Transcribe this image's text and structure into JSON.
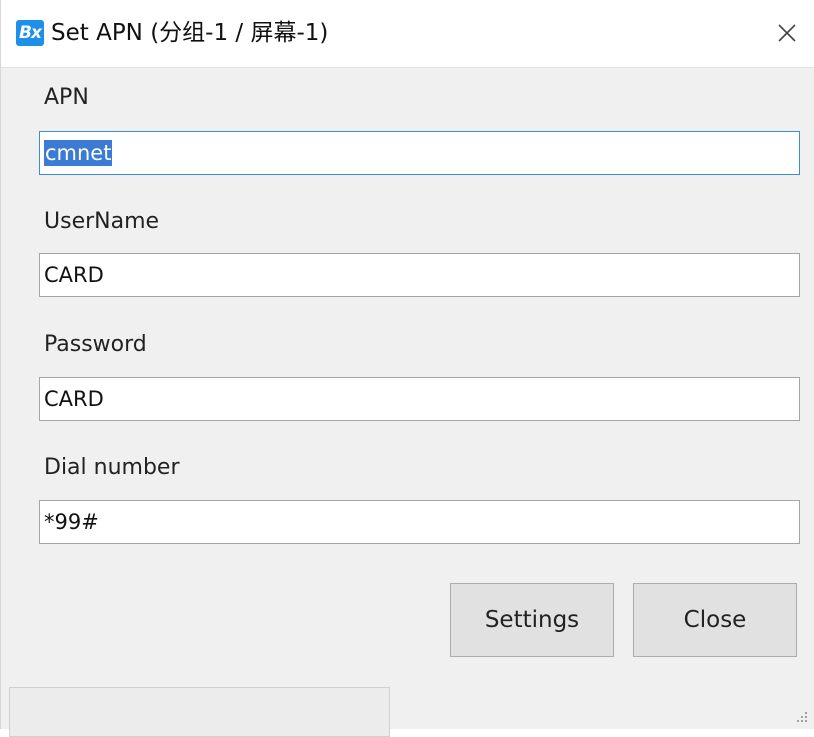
{
  "window": {
    "title": "Set APN  (分组-1 / 屏幕-1)",
    "app_icon_text": "Bx",
    "close_icon": "close-icon"
  },
  "form": {
    "apn_label": "APN",
    "apn_value": "cmnet",
    "username_label": "UserName",
    "username_value": "CARD",
    "password_label": "Password",
    "password_value": "CARD",
    "dial_label": "Dial number",
    "dial_value": "*99#"
  },
  "buttons": {
    "settings_label": "Settings",
    "close_label": "Close"
  },
  "colors": {
    "accent": "#1e90e8",
    "selection": "#3b7bd4",
    "focus_border": "#3c8fd6"
  }
}
